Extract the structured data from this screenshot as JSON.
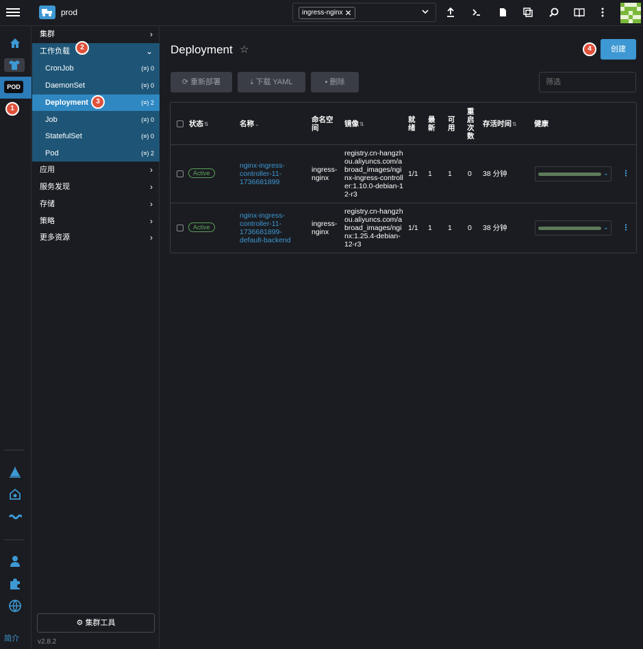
{
  "topbar": {
    "cluster": "prod",
    "namespace_chip": "ingress-nginx",
    "icons": [
      "upload-icon",
      "terminal-icon",
      "file-icon",
      "copy-icon",
      "search-icon",
      "book-icon",
      "more-vertical-icon"
    ]
  },
  "rail": {
    "pod_badge": "POD",
    "footer": "简介",
    "icons": [
      "home-icon",
      "shirt-icon",
      "helm-icon",
      "storage-icon",
      "network-icon",
      "user-icon",
      "extension-icon",
      "globe-icon"
    ]
  },
  "nav": {
    "groups": [
      {
        "label": "集群"
      },
      {
        "label": "工作负载"
      },
      {
        "label": "应用"
      },
      {
        "label": "服务发现"
      },
      {
        "label": "存储"
      },
      {
        "label": "策略"
      },
      {
        "label": "更多资源"
      }
    ],
    "workload_items": [
      {
        "label": "CronJob",
        "count": "0"
      },
      {
        "label": "DaemonSet",
        "count": "0"
      },
      {
        "label": "Deployment",
        "count": "2"
      },
      {
        "label": "Job",
        "count": "0"
      },
      {
        "label": "StatefulSet",
        "count": "0"
      },
      {
        "label": "Pod",
        "count": "2"
      }
    ],
    "cluster_tools": "集群工具",
    "version": "v2.8.2"
  },
  "steps": [
    "1",
    "2",
    "3",
    "4"
  ],
  "main": {
    "title": "Deployment",
    "create_label": "创建",
    "actions": {
      "redeploy": "重新部署",
      "download": "下载 YAML",
      "delete": "删除"
    },
    "filter_placeholder": "筛选",
    "columns": {
      "state": "状态",
      "name": "名称",
      "namespace": "命名空间",
      "image": "镜像",
      "ready": "就绪",
      "uptodate": "最新",
      "available": "可用",
      "restarts": "重启次数",
      "age": "存活时间",
      "health": "健康"
    },
    "rows": [
      {
        "state": "Active",
        "name": "nginx-ingress-controller-11-1736681899",
        "namespace": "ingress-nginx",
        "image": "registry.cn-hangzhou.aliyuncs.com/abroad_images/nginx-ingress-controller:1.10.0-debian-12-r3",
        "ready": "1/1",
        "uptodate": "1",
        "available": "1",
        "restarts": "0",
        "age": "38 分钟"
      },
      {
        "state": "Active",
        "name": "nginx-ingress-controller-11-1736681899-default-backend",
        "namespace": "ingress-nginx",
        "image": "registry.cn-hangzhou.aliyuncs.com/abroad_images/nginx:1.25.4-debian-12-r3",
        "ready": "1/1",
        "uptodate": "1",
        "available": "1",
        "restarts": "0",
        "age": "38 分钟"
      }
    ]
  },
  "colors": {
    "accent": "#3d98d3",
    "step": "#e0513b",
    "active_green": "#5aa45a"
  }
}
